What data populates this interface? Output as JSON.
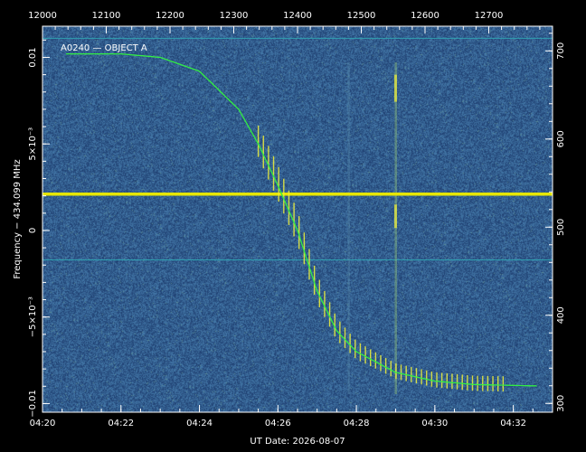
{
  "chart_data": {
    "type": "heatmap",
    "subtype": "waterfall spectrogram",
    "annotation": "A0240 — OBJECT A",
    "xlabel": "UT Date: 2026-08-07",
    "ylabel": "Frequency − 434.099 MHz",
    "x_bottom": {
      "lim": [
        "04:20",
        "04:33"
      ],
      "ticks": [
        "04:20",
        "04:22",
        "04:24",
        "04:26",
        "04:28",
        "04:30",
        "04:32"
      ]
    },
    "x_top": {
      "lim": [
        12000,
        12800
      ],
      "ticks": [
        12000,
        12100,
        12200,
        12300,
        12400,
        12500,
        12600,
        12700
      ]
    },
    "y_left": {
      "lim": [
        -0.0105,
        0.0118
      ],
      "ticks": [
        {
          "value": 0.01,
          "label": "0.01"
        },
        {
          "value": 0.005,
          "label": "5×10⁻³"
        },
        {
          "value": 0,
          "label": "0"
        },
        {
          "value": -0.005,
          "label": "−5×10⁻³"
        },
        {
          "value": -0.01,
          "label": "−0.01"
        }
      ]
    },
    "y_right": {
      "lim": [
        290,
        728
      ],
      "ticks": [
        300,
        400,
        500,
        600,
        700
      ]
    },
    "features": {
      "fit_curve": {
        "color": "#33ee44",
        "points": [
          {
            "t": "04:20.6",
            "f": 0.0102
          },
          {
            "t": "04:22.0",
            "f": 0.0102
          },
          {
            "t": "04:23.0",
            "f": 0.01
          },
          {
            "t": "04:24.0",
            "f": 0.0092
          },
          {
            "t": "04:25.0",
            "f": 0.007
          },
          {
            "t": "04:25.5",
            "f": 0.005
          },
          {
            "t": "04:26.0",
            "f": 0.0026
          },
          {
            "t": "04:26.5",
            "f": 0.0
          },
          {
            "t": "04:27.0",
            "f": -0.0035
          },
          {
            "t": "04:27.5",
            "f": -0.0058
          },
          {
            "t": "04:28.0",
            "f": -0.007
          },
          {
            "t": "04:29.0",
            "f": -0.0082
          },
          {
            "t": "04:30.0",
            "f": -0.0087
          },
          {
            "t": "04:31.0",
            "f": -0.0089
          },
          {
            "t": "04:33.0",
            "f": -0.009
          }
        ]
      },
      "carrier_line": {
        "f": 0.0021,
        "color": "#e6e600"
      },
      "reference_lines": [
        0.0111,
        -0.0017
      ],
      "interference_columns": [
        "04:27.8",
        "04:29.0"
      ],
      "signal_window": [
        "04:25.5",
        "04:31.8"
      ]
    },
    "colors": {
      "background": "#000000",
      "plot_base": "#24487a",
      "noise": "#3a6aa0",
      "signal": "#f2f23a",
      "fit": "#33ee44",
      "axis": "#ffffff",
      "reference_line": "#2fa0b0"
    },
    "grid": false,
    "legend": "none"
  }
}
